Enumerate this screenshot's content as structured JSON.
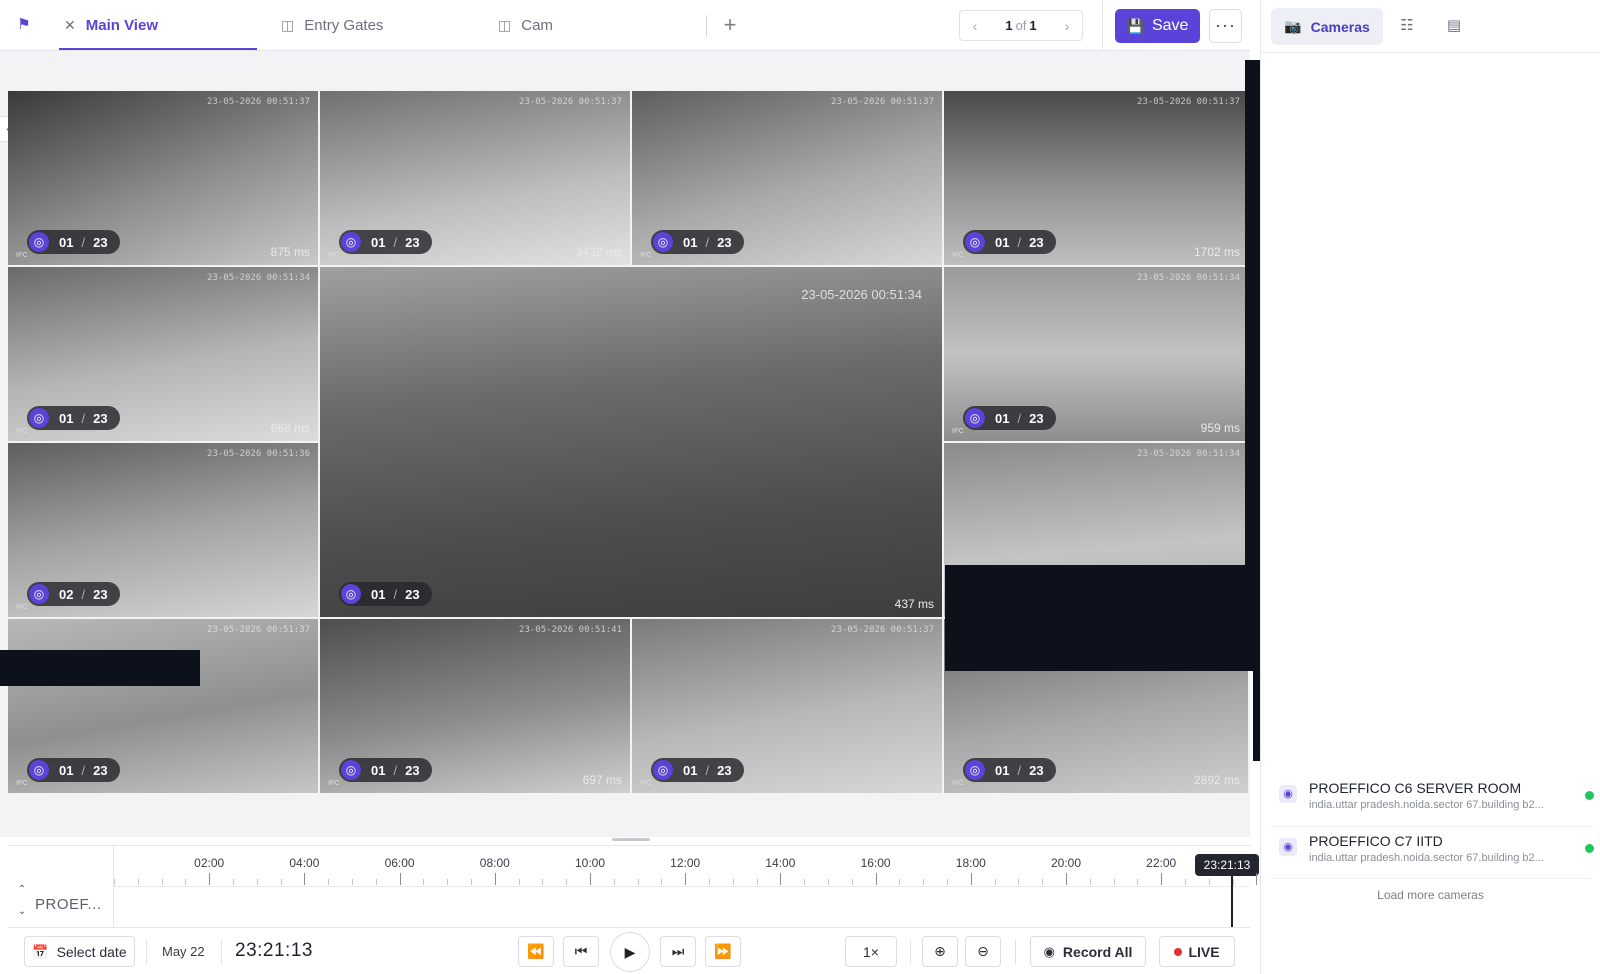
{
  "tabs": [
    {
      "label": "Main View",
      "icon": "close-icon",
      "active": true
    },
    {
      "label": "Entry Gates",
      "icon": "grid-icon",
      "active": false
    },
    {
      "label": "Cam",
      "icon": "grid-icon",
      "active": false
    }
  ],
  "pager": {
    "current": "1",
    "of": "of",
    "total": "1"
  },
  "toolbar": {
    "save_label": "Save",
    "more_label": "···"
  },
  "cameras": [
    {
      "id": "c1",
      "ts": "23-05-2026 00:51:37",
      "latency": "875 ms",
      "ipc": "IPC",
      "badge_a": "01",
      "badge_b": "23"
    },
    {
      "id": "c2",
      "ts": "23-05-2026 00:51:37",
      "latency": "3432 ms",
      "ipc": "IPC",
      "badge_a": "01",
      "badge_b": "23"
    },
    {
      "id": "c3",
      "ts": "23-05-2026 00:51:37",
      "latency": "",
      "ipc": "IPC",
      "badge_a": "01",
      "badge_b": "23"
    },
    {
      "id": "c4",
      "ts": "23-05-2026 00:51:37",
      "latency": "1702 ms",
      "ipc": "IPC",
      "badge_a": "01",
      "badge_b": "23"
    },
    {
      "id": "c5",
      "ts": "23-05-2026 00:51:34",
      "latency": "668 ms",
      "ipc": "IPC",
      "badge_a": "01",
      "badge_b": "23"
    },
    {
      "id": "c6",
      "ts": "23-05-2026 00:51:34",
      "latency": "437 ms",
      "ipc": "",
      "badge_a": "01",
      "badge_b": "23"
    },
    {
      "id": "c7",
      "ts": "23-05-2026 00:51:34",
      "latency": "959 ms",
      "ipc": "IPC",
      "badge_a": "01",
      "badge_b": "23"
    },
    {
      "id": "c8",
      "ts": "23-05-2026 00:51:36",
      "latency": "",
      "ipc": "IPC",
      "badge_a": "02",
      "badge_b": "23"
    },
    {
      "id": "c9",
      "ts": "23-05-2026 00:51:34",
      "latency": "",
      "ipc": "",
      "badge_a": "",
      "badge_b": ""
    },
    {
      "id": "c10",
      "ts": "23-05-2026 00:51:37",
      "latency": "",
      "ipc": "IPC",
      "badge_a": "01",
      "badge_b": "23"
    },
    {
      "id": "c11",
      "ts": "23-05-2026 00:51:41",
      "latency": "697 ms",
      "ipc": "IPC",
      "badge_a": "01",
      "badge_b": "23"
    },
    {
      "id": "c12",
      "ts": "23-05-2026 00:51:37",
      "latency": "",
      "ipc": "IPC",
      "badge_a": "01",
      "badge_b": "23"
    },
    {
      "id": "c13",
      "ts": "23-05-2026 00:51:37",
      "latency": "2892 ms",
      "ipc": "IPC",
      "badge_a": "01",
      "badge_b": "23"
    }
  ],
  "timeline": {
    "hours": [
      "02:00",
      "04:00",
      "06:00",
      "08:00",
      "10:00",
      "12:00",
      "14:00",
      "16:00",
      "18:00",
      "20:00",
      "22:00"
    ],
    "cursor_time": "23:21:13",
    "row_label": "PROEF..."
  },
  "controls": {
    "select_date": "Select date",
    "date": "May 22",
    "time": "23:21:13",
    "speed": "1×",
    "record_all": "Record All",
    "live": "LIVE"
  },
  "right_panel": {
    "tab_cameras": "Cameras",
    "camera_list": [
      {
        "name": "PROEFFICO C6 SERVER ROOM",
        "path": "india.uttar pradesh.noida.sector 67.building b2...",
        "status_color": "#22c55e"
      },
      {
        "name": "PROEFFICO C7 IITD",
        "path": "india.uttar pradesh.noida.sector 67.building b2...",
        "status_color": "#22c55e"
      }
    ],
    "load_more": "Load more cameras"
  },
  "colors": {
    "accent": "#5a43d9",
    "live": "#e0312c",
    "online": "#22c55e"
  }
}
